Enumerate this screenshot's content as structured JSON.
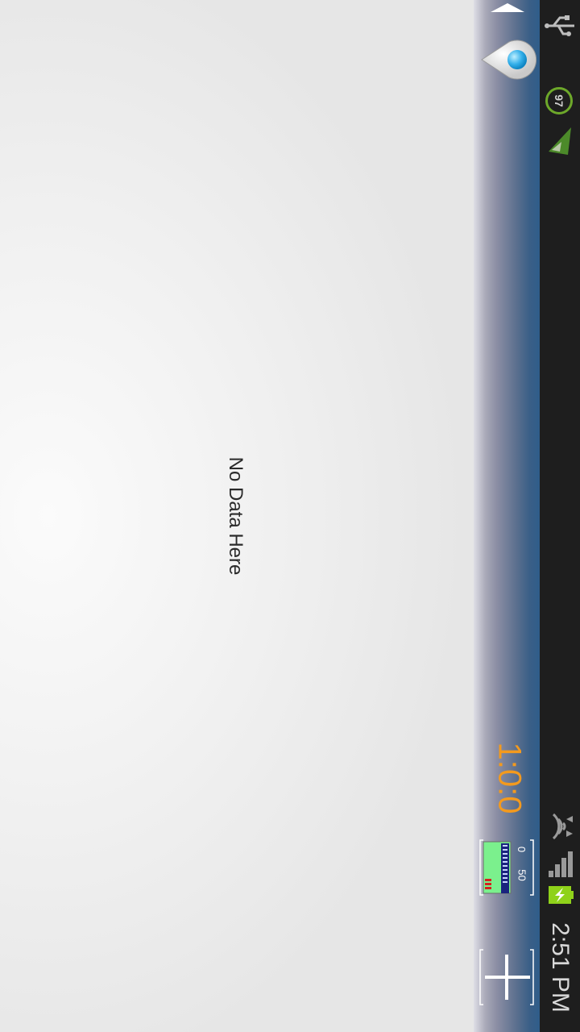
{
  "status_bar": {
    "time": "2:51 PM",
    "badge_value": "97",
    "icons": [
      "usb-icon",
      "notification-badge",
      "send-icon",
      "data-transfer-icon",
      "wifi-icon",
      "signal-icon",
      "battery-charging-icon"
    ]
  },
  "action_bar": {
    "timer": "1:0:0",
    "meter": {
      "min_label": "0",
      "max_label": "50"
    },
    "icons": [
      "up-caret-icon",
      "location-pin-icon",
      "meter-icon",
      "add-icon"
    ]
  },
  "content": {
    "empty_message": "No Data Here"
  },
  "colors": {
    "status_bar_bg": "#1e1e1e",
    "timer_text": "#f39a1e",
    "action_bar_accent": "#2f5d8a"
  }
}
